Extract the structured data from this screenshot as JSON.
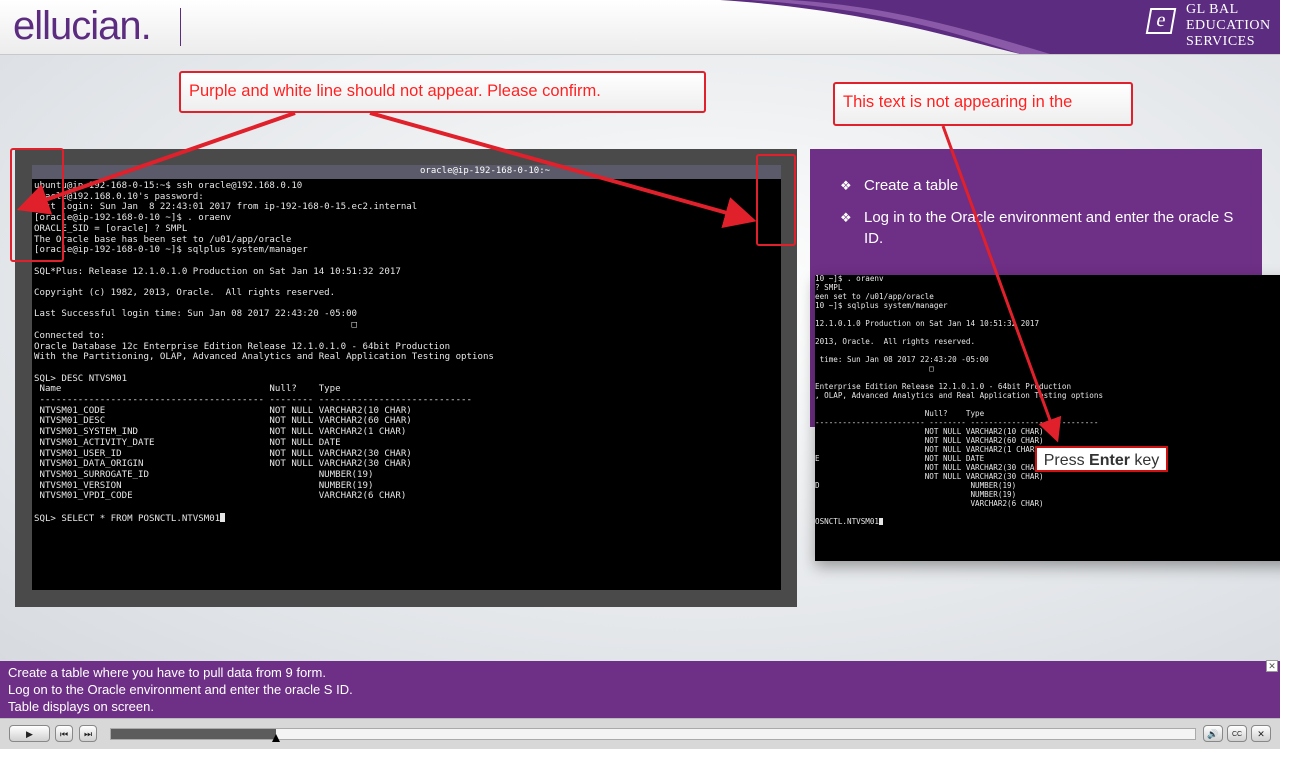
{
  "header": {
    "logo_text": "ellucian.",
    "brand_e": "e",
    "brand_lines": [
      "GL BAL",
      "EDUCATION",
      "SERVICES"
    ]
  },
  "terminal": {
    "title": "oracle@ip-192-168-0-10:~",
    "lines": [
      "ubuntu@ip-192-168-0-15:~$ ssh oracle@192.168.0.10",
      "oracle@192.168.0.10's password:",
      "Last login: Sun Jan  8 22:43:01 2017 from ip-192-168-0-15.ec2.internal",
      "[oracle@ip-192-168-0-10 ~]$ . oraenv",
      "ORACLE_SID = [oracle] ? SMPL",
      "The Oracle base has been set to /u01/app/oracle",
      "[oracle@ip-192-168-0-10 ~]$ sqlplus system/manager",
      "",
      "SQL*Plus: Release 12.1.0.1.0 Production on Sat Jan 14 10:51:32 2017",
      "",
      "Copyright (c) 1982, 2013, Oracle.  All rights reserved.",
      "",
      "Last Successful login time: Sun Jan 08 2017 22:43:20 -05:00",
      "                                                          □",
      "Connected to:",
      "Oracle Database 12c Enterprise Edition Release 12.1.0.1.0 - 64bit Production",
      "With the Partitioning, OLAP, Advanced Analytics and Real Application Testing options",
      "",
      "SQL> DESC NTVSM01",
      " Name                                      Null?    Type",
      " ----------------------------------------- -------- ----------------------------",
      " NTVSM01_CODE                              NOT NULL VARCHAR2(10 CHAR)",
      " NTVSM01_DESC                              NOT NULL VARCHAR2(60 CHAR)",
      " NTVSM01_SYSTEM_IND                        NOT NULL VARCHAR2(1 CHAR)",
      " NTVSM01_ACTIVITY_DATE                     NOT NULL DATE",
      " NTVSM01_USER_ID                           NOT NULL VARCHAR2(30 CHAR)",
      " NTVSM01_DATA_ORIGIN                       NOT NULL VARCHAR2(30 CHAR)",
      " NTVSM01_SURROGATE_ID                               NUMBER(19)",
      " NTVSM01_VERSION                                    NUMBER(19)",
      " NTVSM01_VPDI_CODE                                  VARCHAR2(6 CHAR)",
      ""
    ],
    "prompt_line": "SQL> SELECT * FROM POSNCTL.NTVSM01"
  },
  "panel": {
    "bullets": [
      "Create a table",
      "Log in to the Oracle environment and enter the oracle S ID."
    ],
    "bullet_glyph": "❖"
  },
  "zoom": {
    "lines": [
      "10 ~]$ . oraenv",
      "? SMPL",
      "een set to /u01/app/oracle",
      "10 ~]$ sqlplus system/manager",
      "",
      "12.1.0.1.0 Production on Sat Jan 14 10:51:32 2017",
      "",
      "2013, Oracle.  All rights reserved.",
      "",
      " time: Sun Jan 08 2017 22:43:20 -05:00",
      "                         □",
      "",
      "Enterprise Edition Release 12.1.0.1.0 - 64bit Production",
      ", OLAP, Advanced Analytics and Real Application Testing options",
      "",
      "                        Null?    Type",
      "------------------------ -------- ----------------------------",
      "                        NOT NULL VARCHAR2(10 CHAR)",
      "                        NOT NULL VARCHAR2(60 CHAR)",
      "                        NOT NULL VARCHAR2(1 CHAR)",
      "E                       NOT NULL DATE",
      "                        NOT NULL VARCHAR2(30 CHAR)",
      "                        NOT NULL VARCHAR2(30 CHAR)",
      "D                                 NUMBER(19)",
      "                                  NUMBER(19)",
      "                                  VARCHAR2(6 CHAR)",
      ""
    ],
    "prompt_line": "OSNCTL.NTVSM01",
    "press_prefix": "Press ",
    "press_key": "Enter",
    "press_suffix": " key"
  },
  "callouts": {
    "left": "Purple and white line should not appear. Please confirm.",
    "right": "This text is not appearing in the"
  },
  "caption": {
    "lines": [
      "Create a table where you have to pull data from 9 form.",
      "Log on to the Oracle environment and enter the oracle S ID.",
      "Table displays on screen."
    ],
    "close_glyph": "✕"
  },
  "controls": {
    "play": "▶",
    "prev": "⏮",
    "next": "⏭",
    "volume": "🔊",
    "cc": "CC",
    "close": "✕",
    "progress": 0.152
  },
  "colors": {
    "brand_purple": "#6e2f86",
    "annotation_red": "#e0202a",
    "terminal_bg": "#000000"
  }
}
